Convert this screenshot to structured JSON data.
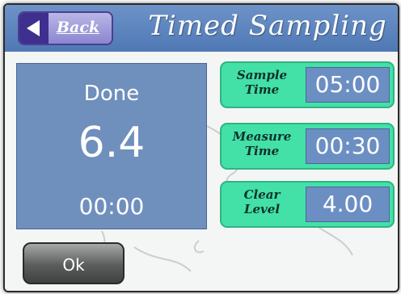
{
  "header": {
    "back_label": "Back",
    "title": "Timed Sampling"
  },
  "status": {
    "state": "Done",
    "value": "6.4",
    "time": "00:00"
  },
  "params": [
    {
      "label_line1": "Sample",
      "label_line2": "Time",
      "value": "05:00"
    },
    {
      "label_line1": "Measure",
      "label_line2": "Time",
      "value": "00:30"
    },
    {
      "label_line1": "Clear",
      "label_line2": "Level",
      "value": "4.00"
    }
  ],
  "footer": {
    "ok_label": "Ok"
  },
  "colors": {
    "header": "#5a82bd",
    "panel": "#6f8fbd",
    "param_label_bg": "#43e0a8",
    "back_button": "#9f9bda",
    "ok_button": "#5b5d5c"
  },
  "icons": {
    "back": "left-arrow-icon"
  }
}
